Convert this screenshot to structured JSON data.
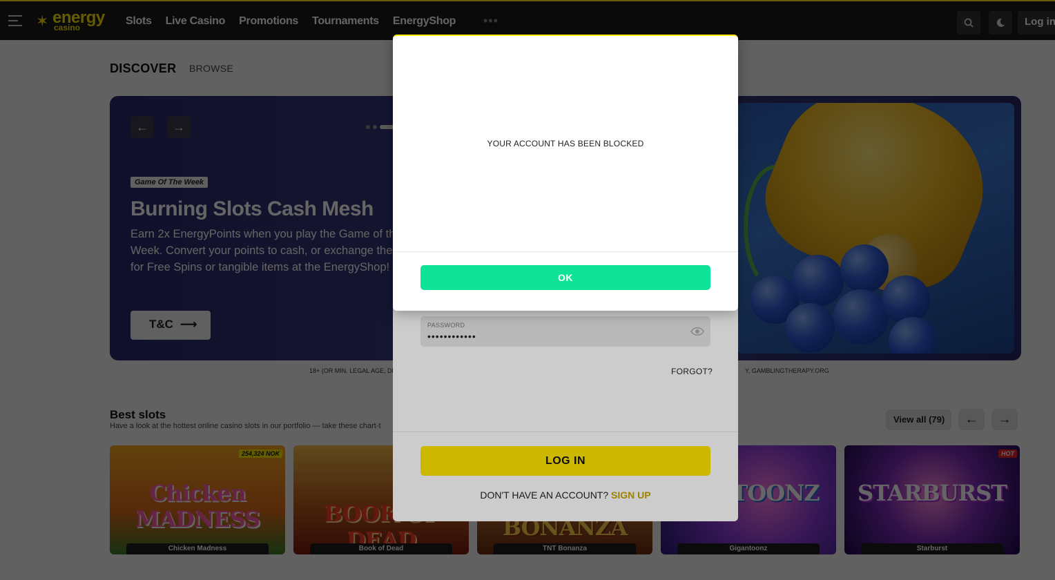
{
  "header": {
    "logo_main": "energy",
    "logo_sub": "casino",
    "nav": [
      "Slots",
      "Live Casino",
      "Promotions",
      "Tournaments",
      "EnergyShop"
    ],
    "more": "•••",
    "login_label": "Log in"
  },
  "page": {
    "tab_discover": "DISCOVER",
    "tab_browse": "BROWSE"
  },
  "hero": {
    "badge": "Game Of The Week",
    "title": "Burning Slots Cash Mesh",
    "description": "Earn 2x EnergyPoints when you play the Game of the Week. Convert your points to cash, or exchange them for Free Spins or tangible items at the EnergyShop!",
    "tnc_label": "T&C",
    "disclaimer_left": "18+ (OR MIN. LEGAL AGE, DE",
    "disclaimer_right": "Y, GAMBLINGTHERAPY.ORG"
  },
  "best_slots": {
    "title": "Best slots",
    "subtitle": "Have a look at the hottest online casino slots in our portfolio — take these chart-t",
    "view_all": "View all (79)",
    "games": [
      {
        "name": "Chicken Madness",
        "art": "Chicken MADNESS",
        "jackpot": "254,324 NOK",
        "hot": ""
      },
      {
        "name": "Book of Dead",
        "art": "BOOK OF DEAD",
        "jackpot": "",
        "hot": ""
      },
      {
        "name": "TNT Bonanza",
        "art": "BONANZA",
        "jackpot": "",
        "hot": ""
      },
      {
        "name": "Gigantoonz",
        "art": "GANTOONZ",
        "jackpot": "",
        "hot": ""
      },
      {
        "name": "Starburst",
        "art": "STARBURST",
        "jackpot": "",
        "hot": "HOT"
      }
    ]
  },
  "login_modal": {
    "password_label": "PASSWORD",
    "password_value": "••••••••••••",
    "forgot": "FORGOT?",
    "login_button": "LOG IN",
    "no_account": "DON'T HAVE AN ACCOUNT?",
    "sign_up": "SIGN UP"
  },
  "dialog": {
    "message": "YOUR ACCOUNT HAS BEEN BLOCKED",
    "ok_label": "OK"
  },
  "colors": {
    "brand_yellow": "#ffe600",
    "ok_green": "#0fe398",
    "header_bg": "#1a1a1a"
  }
}
